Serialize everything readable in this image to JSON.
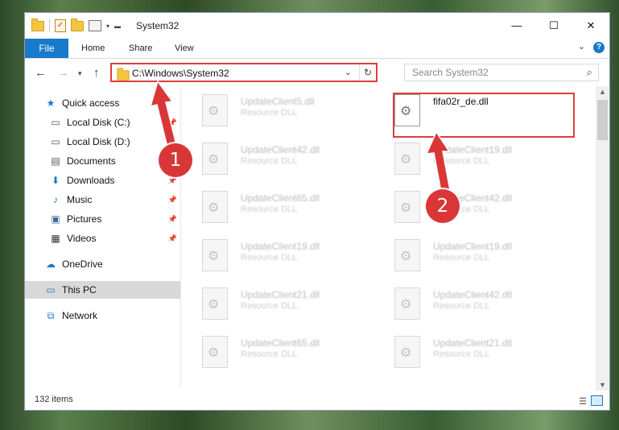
{
  "window": {
    "title": "System32",
    "controls": {
      "minimize": "—",
      "maximize": "☐",
      "close": "✕"
    }
  },
  "ribbon": {
    "tabs": [
      "File",
      "Home",
      "Share",
      "View"
    ],
    "help": "?"
  },
  "address": {
    "path": "C:\\Windows\\System32"
  },
  "search": {
    "placeholder": "Search System32"
  },
  "sidebar": {
    "items": [
      {
        "label": "Quick access",
        "icon": "star-icon"
      },
      {
        "label": "Local Disk (C:)",
        "icon": "drive-icon"
      },
      {
        "label": "Local Disk (D:)",
        "icon": "drive-icon"
      },
      {
        "label": "Documents",
        "icon": "documents-icon"
      },
      {
        "label": "Downloads",
        "icon": "download-icon"
      },
      {
        "label": "Music",
        "icon": "music-icon"
      },
      {
        "label": "Pictures",
        "icon": "pictures-icon"
      },
      {
        "label": "Videos",
        "icon": "videos-icon"
      },
      {
        "label": "OneDrive",
        "icon": "cloud-icon"
      },
      {
        "label": "This PC",
        "icon": "computer-icon"
      },
      {
        "label": "Network",
        "icon": "network-icon"
      }
    ]
  },
  "files": {
    "left": [
      {
        "name": "UpdateClient5.dll",
        "type": "Resource DLL"
      },
      {
        "name": "UpdateClient42.dll",
        "type": "Resource DLL"
      },
      {
        "name": "UpdateClient65.dll",
        "type": "Resource DLL"
      },
      {
        "name": "UpdateClient19.dll",
        "type": "Resource DLL"
      },
      {
        "name": "UpdateClient21.dll",
        "type": "Resource DLL"
      },
      {
        "name": "UpdateClient65.dll",
        "type": "Resource DLL"
      }
    ],
    "right": [
      {
        "name": "fifa02r_de.dll",
        "type": ""
      },
      {
        "name": "UpdateClient19.dll",
        "type": "Resource DLL"
      },
      {
        "name": "UpdateClient42.dll",
        "type": "Resource DLL"
      },
      {
        "name": "UpdateClient19.dll",
        "type": "Resource DLL"
      },
      {
        "name": "UpdateClient42.dll",
        "type": "Resource DLL"
      },
      {
        "name": "UpdateClient21.dll",
        "type": "Resource DLL"
      }
    ]
  },
  "status": {
    "item_count": "132 items"
  },
  "annotations": {
    "step1": "1",
    "step2": "2",
    "color": "#d93737"
  }
}
